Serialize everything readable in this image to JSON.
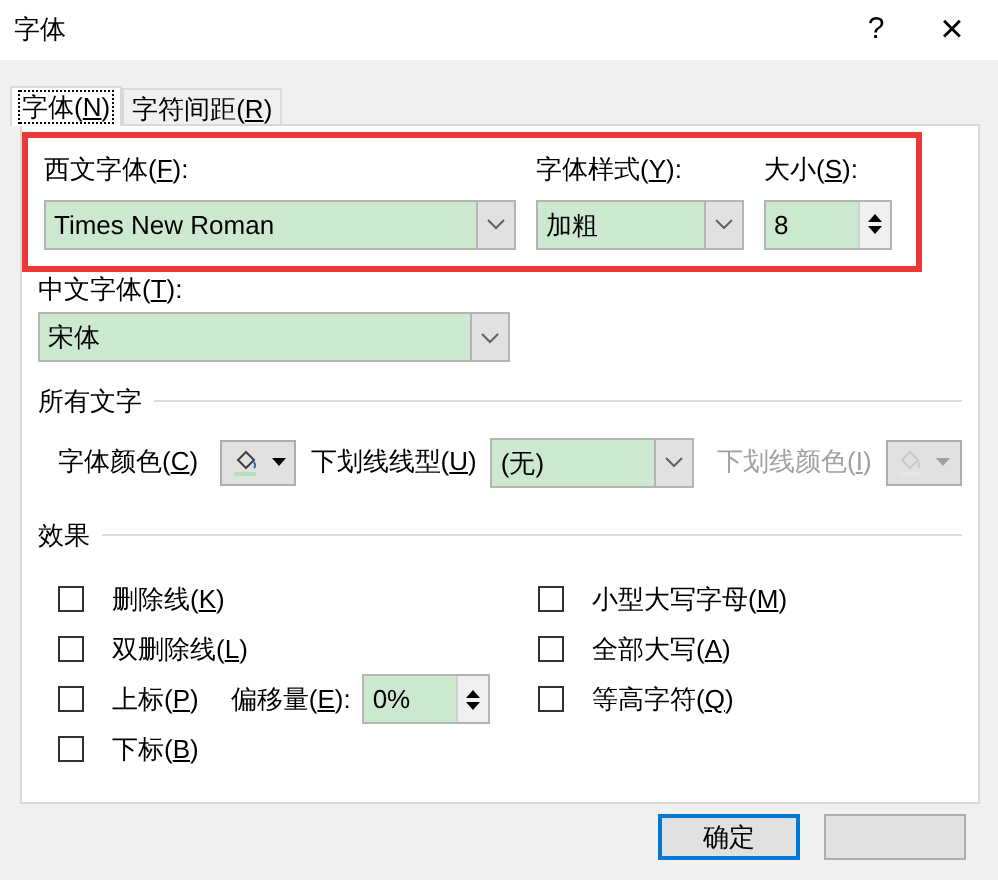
{
  "window": {
    "title": "字体",
    "help": "?",
    "close": "×"
  },
  "tabs": [
    {
      "label": "字体(N)",
      "selected": true
    },
    {
      "label": "字符间距(R)",
      "selected": false
    }
  ],
  "highlight": true,
  "western_font": {
    "label": "西文字体(F):",
    "value": "Times New Roman"
  },
  "font_style": {
    "label": "字体样式(Y):",
    "value": "加粗"
  },
  "size": {
    "label": "大小(S):",
    "value": "8"
  },
  "chinese_font": {
    "label": "中文字体(T):",
    "value": "宋体"
  },
  "all_text": {
    "heading": "所有文字",
    "font_color": {
      "label": "字体颜色(C)",
      "disabled": false
    },
    "underline_style": {
      "label": "下划线线型(U)",
      "value": "(无)"
    },
    "underline_color": {
      "label": "下划线颜色(I)",
      "disabled": true
    }
  },
  "effects": {
    "heading": "效果",
    "left": [
      {
        "label": "删除线(K)",
        "checked": false
      },
      {
        "label": "双删除线(L)",
        "checked": false
      },
      {
        "label": "上标(P)",
        "checked": false
      },
      {
        "label": "下标(B)",
        "checked": false
      }
    ],
    "offset": {
      "label": "偏移量(E):",
      "value": "0%"
    },
    "right": [
      {
        "label": "小型大写字母(M)",
        "checked": false
      },
      {
        "label": "全部大写(A)",
        "checked": false
      },
      {
        "label": "等高字符(Q)",
        "checked": false
      }
    ]
  },
  "buttons": [
    {
      "label": "确定",
      "default": true
    },
    {
      "default": false
    }
  ]
}
